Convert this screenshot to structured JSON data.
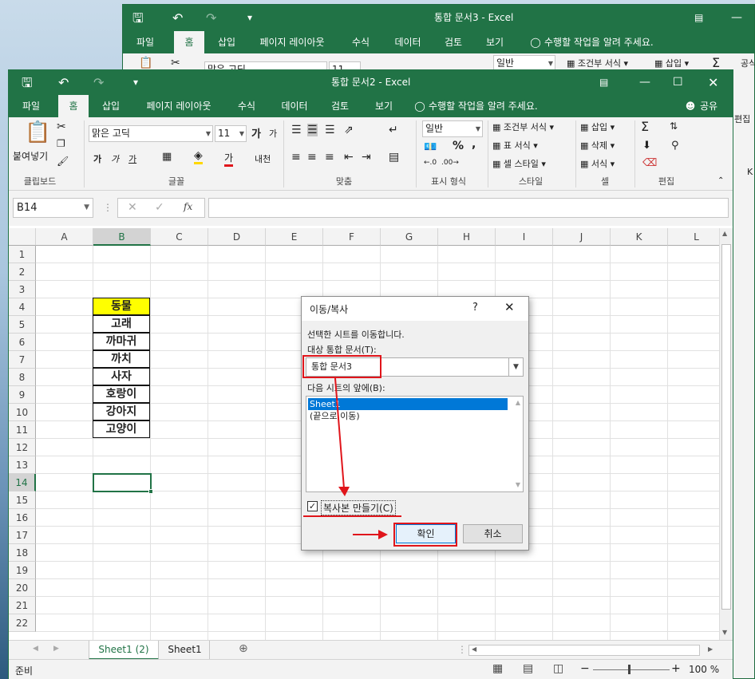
{
  "back_window": {
    "title": "통합 문서3  -  Excel",
    "tabs": [
      "파일",
      "홈",
      "삽입",
      "페이지 레이아웃",
      "수식",
      "데이터",
      "검토",
      "보기"
    ],
    "tell_me": "수행할 작업을 알려 주세요.",
    "font_name": "맑은 고딕",
    "font_size": "11",
    "number_format": "일반",
    "conditional_format": "조건부 서식",
    "insert": "삽입",
    "formula_hint": "공식",
    "right_edge_label": "편집",
    "col_letter": "K"
  },
  "front_window": {
    "title": "통합 문서2  -  Excel",
    "tabs": [
      "파일",
      "홈",
      "삽입",
      "페이지 레이아웃",
      "수식",
      "데이터",
      "검토",
      "보기"
    ],
    "tell_me": "수행할 작업을 알려 주세요.",
    "share": "공유",
    "ribbon": {
      "clipboard": {
        "paste": "붙여넣기",
        "label": "클립보드"
      },
      "font": {
        "name": "맑은 고딕",
        "size": "11",
        "label": "글꼴",
        "bold": "가",
        "italic": "가",
        "underline": "가",
        "grow": "가",
        "shrink": "가",
        "color": "가",
        "phonetic": "내천"
      },
      "alignment": {
        "label": "맞춤"
      },
      "number": {
        "format": "일반",
        "label": "표시 형식",
        "percent": "%",
        "comma": ","
      },
      "styles": {
        "conditional": "조건부 서식",
        "table": "표 서식",
        "cell": "셀 스타일",
        "label": "스타일"
      },
      "cells": {
        "insert": "삽입",
        "delete": "삭제",
        "format": "서식",
        "label": "셀"
      },
      "editing": {
        "label": "편집"
      }
    },
    "name_box": "B14",
    "columns": [
      "A",
      "B",
      "C",
      "D",
      "E",
      "F",
      "G",
      "H",
      "I",
      "J",
      "K",
      "L"
    ],
    "selected_column": "B",
    "rows": [
      "1",
      "2",
      "3",
      "4",
      "5",
      "6",
      "7",
      "8",
      "9",
      "10",
      "11",
      "12",
      "13",
      "14",
      "15",
      "16",
      "17",
      "18",
      "19",
      "20",
      "21",
      "22"
    ],
    "selected_row": "14",
    "cells_b": [
      "동물",
      "고래",
      "까마귀",
      "까치",
      "사자",
      "호랑이",
      "강아지",
      "고양이"
    ],
    "header_fill": "#ffff00",
    "sheet_tabs": [
      "Sheet1 (2)",
      "Sheet1"
    ],
    "active_sheet": "Sheet1 (2)",
    "status": "준비",
    "zoom": "100 %"
  },
  "dialog": {
    "title": "이동/복사",
    "help": "?",
    "desc": "선택한 시트를 이동합니다.",
    "target_label": "대상 통합 문서(T):",
    "target_value": "통합 문서3",
    "before_label": "다음 시트의 앞에(B):",
    "list": [
      "Sheet1",
      "(끝으로 이동)"
    ],
    "selected_item": "Sheet1",
    "copy_label": "복사본 만들기(C)",
    "copy_checked": true,
    "ok": "확인",
    "cancel": "취소"
  },
  "annotation_color": "#e0151b",
  "accent": "#217346"
}
